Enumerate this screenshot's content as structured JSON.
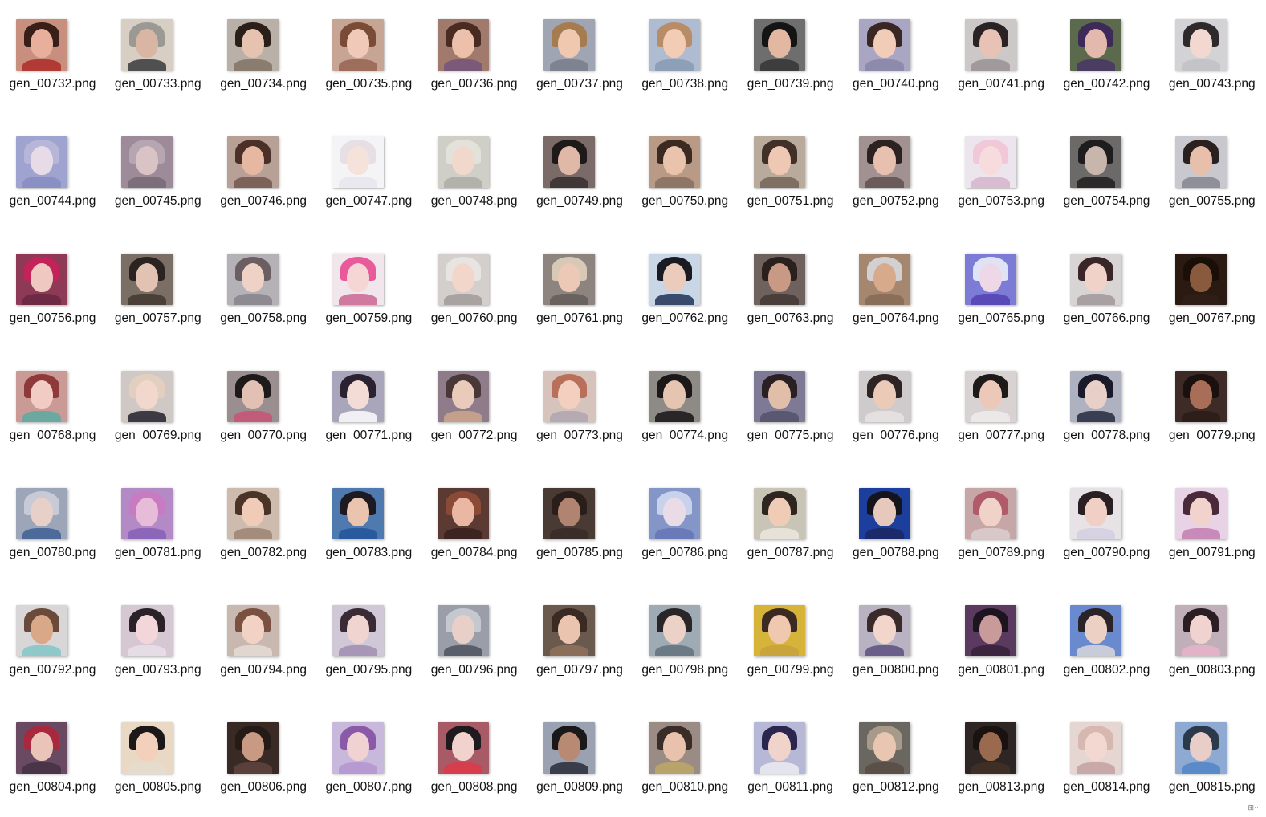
{
  "view": {
    "mode": "large-icons",
    "corner_glyph": "⊞⋯"
  },
  "files": [
    {
      "name": "gen_00732.png",
      "bg": "#c98f7e",
      "skin": "#e8b09c",
      "hair": "#3a1e18",
      "cloth": "#b23a34"
    },
    {
      "name": "gen_00733.png",
      "bg": "#d8cfc4",
      "skin": "#d9b6a4",
      "hair": "#9b9993",
      "cloth": "#505050"
    },
    {
      "name": "gen_00734.png",
      "bg": "#b9b0a8",
      "skin": "#e6c3b1",
      "hair": "#2b1f1a",
      "cloth": "#8a7c6e"
    },
    {
      "name": "gen_00735.png",
      "bg": "#c7a595",
      "skin": "#f0c9b8",
      "hair": "#7a4b36",
      "cloth": "#9d6e5c"
    },
    {
      "name": "gen_00736.png",
      "bg": "#a07a6c",
      "skin": "#ecc0aa",
      "hair": "#4a2b22",
      "cloth": "#7a5a78"
    },
    {
      "name": "gen_00737.png",
      "bg": "#9fa5b3",
      "skin": "#f0c8b0",
      "hair": "#a57c4f",
      "cloth": "#7f8391"
    },
    {
      "name": "gen_00738.png",
      "bg": "#aebbd0",
      "skin": "#f2ccb4",
      "hair": "#b88c66",
      "cloth": "#8e9fb8"
    },
    {
      "name": "gen_00739.png",
      "bg": "#6e6e6e",
      "skin": "#e2b8a2",
      "hair": "#141414",
      "cloth": "#3d3d3d"
    },
    {
      "name": "gen_00740.png",
      "bg": "#a8a6c2",
      "skin": "#f1ccb8",
      "hair": "#3a2622",
      "cloth": "#8d8aab"
    },
    {
      "name": "gen_00741.png",
      "bg": "#ccc8c8",
      "skin": "#e8c2b4",
      "hair": "#2a2326",
      "cloth": "#a09a9c"
    },
    {
      "name": "gen_00742.png",
      "bg": "#5b6a4c",
      "skin": "#e3b8ad",
      "hair": "#3d2a58",
      "cloth": "#4b3c62"
    },
    {
      "name": "gen_00743.png",
      "bg": "#d3d3d6",
      "skin": "#f2d8d0",
      "hair": "#2e2a2c",
      "cloth": "#c3c3c8"
    },
    {
      "name": "gen_00744.png",
      "bg": "#9ea4cf",
      "skin": "#e6dbe6",
      "hair": "#b8b6d8",
      "cloth": "#8a8fc4"
    },
    {
      "name": "gen_00745.png",
      "bg": "#9d8b9a",
      "skin": "#d9c3c4",
      "hair": "#b5a6b2",
      "cloth": "#7d6e7c"
    },
    {
      "name": "gen_00746.png",
      "bg": "#b7a197",
      "skin": "#e6b8a1",
      "hair": "#4a3026",
      "cloth": "#7c6258"
    },
    {
      "name": "gen_00747.png",
      "bg": "#f4f4f7",
      "skin": "#f5e2db",
      "hair": "#e6e0e4",
      "cloth": "#e8e8ee"
    },
    {
      "name": "gen_00748.png",
      "bg": "#cfcfc8",
      "skin": "#f1d8cd",
      "hair": "#e3e2da",
      "cloth": "#b2b2aa"
    },
    {
      "name": "gen_00749.png",
      "bg": "#7a6a68",
      "skin": "#e0b8a7",
      "hair": "#1f1a1a",
      "cloth": "#3f3738"
    },
    {
      "name": "gen_00750.png",
      "bg": "#b99a86",
      "skin": "#e9c3ab",
      "hair": "#3b2a22",
      "cloth": "#8e7666"
    },
    {
      "name": "gen_00751.png",
      "bg": "#b9ab9c",
      "skin": "#eec8b3",
      "hair": "#403028",
      "cloth": "#7e6f62"
    },
    {
      "name": "gen_00752.png",
      "bg": "#a19190",
      "skin": "#e8c0b0",
      "hair": "#2c2221",
      "cloth": "#6a5a5a"
    },
    {
      "name": "gen_00753.png",
      "bg": "#ece5ee",
      "skin": "#f6dcdc",
      "hair": "#f0c8d8",
      "cloth": "#d9bcd2"
    },
    {
      "name": "gen_00754.png",
      "bg": "#6c6a68",
      "skin": "#c8b6ac",
      "hair": "#1e1c1c",
      "cloth": "#2b2929"
    },
    {
      "name": "gen_00755.png",
      "bg": "#c8c8ce",
      "skin": "#e7bfaa",
      "hair": "#2a2020",
      "cloth": "#8f8f99"
    },
    {
      "name": "gen_00756.png",
      "bg": "#8e3a56",
      "skin": "#efc8c2",
      "hair": "#c2245a",
      "cloth": "#6e2a44"
    },
    {
      "name": "gen_00757.png",
      "bg": "#7b6e64",
      "skin": "#e2c2b2",
      "hair": "#2b2320",
      "cloth": "#4a4038"
    },
    {
      "name": "gen_00758.png",
      "bg": "#b4b2b6",
      "skin": "#eed2c6",
      "hair": "#6a5e62",
      "cloth": "#8e8a92"
    },
    {
      "name": "gen_00759.png",
      "bg": "#f0e6ec",
      "skin": "#f5d6d4",
      "hair": "#e85a9a",
      "cloth": "#d07aa0"
    },
    {
      "name": "gen_00760.png",
      "bg": "#d4cfcc",
      "skin": "#f3d6ca",
      "hair": "#e8e4e2",
      "cloth": "#a8a3a0"
    },
    {
      "name": "gen_00761.png",
      "bg": "#8d8480",
      "skin": "#ecc8b6",
      "hair": "#d8c8b6",
      "cloth": "#6a625e"
    },
    {
      "name": "gen_00762.png",
      "bg": "#c9d6e6",
      "skin": "#eacbbc",
      "hair": "#1a1a22",
      "cloth": "#3a4a6a"
    },
    {
      "name": "gen_00763.png",
      "bg": "#6f625e",
      "skin": "#c89a86",
      "hair": "#2a201c",
      "cloth": "#4a3e3a"
    },
    {
      "name": "gen_00764.png",
      "bg": "#a4876e",
      "skin": "#d8aa8c",
      "hair": "#d2d0d0",
      "cloth": "#8a6e58"
    },
    {
      "name": "gen_00765.png",
      "bg": "#7c7cd6",
      "skin": "#eed8e8",
      "hair": "#e0e2f6",
      "cloth": "#5a4ab8"
    },
    {
      "name": "gen_00766.png",
      "bg": "#d9d4d4",
      "skin": "#f0d2c8",
      "hair": "#3a2628",
      "cloth": "#a8a0a2"
    },
    {
      "name": "gen_00767.png",
      "bg": "#2a1a12",
      "skin": "#8a5a3e",
      "hair": "#1a0e08",
      "cloth": "#2e1e16"
    },
    {
      "name": "gen_00768.png",
      "bg": "#c99a96",
      "skin": "#f2ccc4",
      "hair": "#8e3a3a",
      "cloth": "#6aa8a0"
    },
    {
      "name": "gen_00769.png",
      "bg": "#cfc8c4",
      "skin": "#f2d8cc",
      "hair": "#e2cfc0",
      "cloth": "#3e3a44"
    },
    {
      "name": "gen_00770.png",
      "bg": "#9a8e90",
      "skin": "#e2c0b4",
      "hair": "#1e1a1c",
      "cloth": "#c25a7a"
    },
    {
      "name": "gen_00771.png",
      "bg": "#a9a6bc",
      "skin": "#f4dcd6",
      "hair": "#2a2230",
      "cloth": "#f0f0f4"
    },
    {
      "name": "gen_00772.png",
      "bg": "#8e7c8a",
      "skin": "#eacaba",
      "hair": "#4a3838",
      "cloth": "#c4a08c"
    },
    {
      "name": "gen_00773.png",
      "bg": "#d6c4bc",
      "skin": "#f2cfbe",
      "hair": "#b8705a",
      "cloth": "#b6aab2"
    },
    {
      "name": "gen_00774.png",
      "bg": "#8e8a86",
      "skin": "#e6c4b2",
      "hair": "#1c1818",
      "cloth": "#2a2628"
    },
    {
      "name": "gen_00775.png",
      "bg": "#7e7a96",
      "skin": "#e0bea8",
      "hair": "#2a2024",
      "cloth": "#5a5870"
    },
    {
      "name": "gen_00776.png",
      "bg": "#cfcacc",
      "skin": "#eccab8",
      "hair": "#2e2424",
      "cloth": "#e4e0e0"
    },
    {
      "name": "gen_00777.png",
      "bg": "#d8d2d2",
      "skin": "#ecc8b8",
      "hair": "#1e1a1a",
      "cloth": "#ece8e8"
    },
    {
      "name": "gen_00778.png",
      "bg": "#aeb2c0",
      "skin": "#e8d0c8",
      "hair": "#1a1a2a",
      "cloth": "#3a3e52"
    },
    {
      "name": "gen_00779.png",
      "bg": "#3e2a26",
      "skin": "#a86e58",
      "hair": "#1a100e",
      "cloth": "#2e1e1a"
    },
    {
      "name": "gen_00780.png",
      "bg": "#9ca6b8",
      "skin": "#e6d0c8",
      "hair": "#c8cad6",
      "cloth": "#4c6a9a"
    },
    {
      "name": "gen_00781.png",
      "bg": "#b48ac6",
      "skin": "#e6bcd8",
      "hair": "#c87ac2",
      "cloth": "#8c66b8"
    },
    {
      "name": "gen_00782.png",
      "bg": "#cdbcae",
      "skin": "#f0ccb8",
      "hair": "#4a3428",
      "cloth": "#a48c7c"
    },
    {
      "name": "gen_00783.png",
      "bg": "#4e7ab0",
      "skin": "#eac4ae",
      "hair": "#1e1a22",
      "cloth": "#2a5a9e"
    },
    {
      "name": "gen_00784.png",
      "bg": "#5a3a32",
      "skin": "#eab8a2",
      "hair": "#8a4a36",
      "cloth": "#3e2420"
    },
    {
      "name": "gen_00785.png",
      "bg": "#4a3a34",
      "skin": "#b08470",
      "hair": "#2a1e1a",
      "cloth": "#3a2c28"
    },
    {
      "name": "gen_00786.png",
      "bg": "#8496c8",
      "skin": "#eadce6",
      "hair": "#c8d2ec",
      "cloth": "#6a7ab8"
    },
    {
      "name": "gen_00787.png",
      "bg": "#c8c4b6",
      "skin": "#f0ccb6",
      "hair": "#2e2420",
      "cloth": "#e6e2d8"
    },
    {
      "name": "gen_00788.png",
      "bg": "#1c3e9c",
      "skin": "#e6c8bc",
      "hair": "#14141c",
      "cloth": "#1a2a6a"
    },
    {
      "name": "gen_00789.png",
      "bg": "#c6a6a6",
      "skin": "#f0d2c8",
      "hair": "#b05a6a",
      "cloth": "#d8c8c8"
    },
    {
      "name": "gen_00790.png",
      "bg": "#e6e2e6",
      "skin": "#f0d0c4",
      "hair": "#2a2024",
      "cloth": "#d6d2e2"
    },
    {
      "name": "gen_00791.png",
      "bg": "#e8d2e6",
      "skin": "#f2d2cc",
      "hair": "#4a2a3a",
      "cloth": "#c88ab8"
    },
    {
      "name": "gen_00792.png",
      "bg": "#d8d6d6",
      "skin": "#d8a888",
      "hair": "#6a4a3a",
      "cloth": "#8ec8c8"
    },
    {
      "name": "gen_00793.png",
      "bg": "#d6c8d2",
      "skin": "#f2d6da",
      "hair": "#2a2228",
      "cloth": "#e6dce6"
    },
    {
      "name": "gen_00794.png",
      "bg": "#c8b8b0",
      "skin": "#f2d2c4",
      "hair": "#7a5040",
      "cloth": "#e2d6d0"
    },
    {
      "name": "gen_00795.png",
      "bg": "#d0c8d6",
      "skin": "#f0d4d0",
      "hair": "#3a2a36",
      "cloth": "#a896b6"
    },
    {
      "name": "gen_00796.png",
      "bg": "#9a9ea8",
      "skin": "#e8d0c8",
      "hair": "#c6c8d0",
      "cloth": "#5a5e6a"
    },
    {
      "name": "gen_00797.png",
      "bg": "#6a5a4e",
      "skin": "#eac4ae",
      "hair": "#3a2a22",
      "cloth": "#8a6e5a"
    },
    {
      "name": "gen_00798.png",
      "bg": "#9eaab4",
      "skin": "#ecd2c6",
      "hair": "#2a2628",
      "cloth": "#6c7a86"
    },
    {
      "name": "gen_00799.png",
      "bg": "#d6b43a",
      "skin": "#f0c8b0",
      "hair": "#3a2a22",
      "cloth": "#c8a43a"
    },
    {
      "name": "gen_00800.png",
      "bg": "#b8b2c2",
      "skin": "#f2d6cc",
      "hair": "#3a2a2a",
      "cloth": "#6a5e8a"
    },
    {
      "name": "gen_00801.png",
      "bg": "#5a3a5e",
      "skin": "#c89a9a",
      "hair": "#1e1420",
      "cloth": "#3a243e"
    },
    {
      "name": "gen_00802.png",
      "bg": "#6a8ad0",
      "skin": "#ecd0c4",
      "hair": "#2a2428",
      "cloth": "#c8ccd8"
    },
    {
      "name": "gen_00803.png",
      "bg": "#c0aeb8",
      "skin": "#f0d2ce",
      "hair": "#2a1e24",
      "cloth": "#e2b2c6"
    },
    {
      "name": "gen_00804.png",
      "bg": "#6a4a62",
      "skin": "#eac4b8",
      "hair": "#a8283e",
      "cloth": "#4a3448"
    },
    {
      "name": "gen_00805.png",
      "bg": "#e8d8c4",
      "skin": "#f2d0bc",
      "hair": "#1c181a",
      "cloth": "#e6dccc"
    },
    {
      "name": "gen_00806.png",
      "bg": "#3a2a26",
      "skin": "#c89a84",
      "hair": "#241a16",
      "cloth": "#5a403a"
    },
    {
      "name": "gen_00807.png",
      "bg": "#c8b8dc",
      "skin": "#f0d2d2",
      "hair": "#8a5aa8",
      "cloth": "#b89ad2"
    },
    {
      "name": "gen_00808.png",
      "bg": "#a85a66",
      "skin": "#f2d2cc",
      "hair": "#1e1a1e",
      "cloth": "#d63e4e"
    },
    {
      "name": "gen_00809.png",
      "bg": "#9aa2b2",
      "skin": "#b88a74",
      "hair": "#1a1818",
      "cloth": "#3a3e4a"
    },
    {
      "name": "gen_00810.png",
      "bg": "#9a8c84",
      "skin": "#e8c2ac",
      "hair": "#3a2c26",
      "cloth": "#b8a46a"
    },
    {
      "name": "gen_00811.png",
      "bg": "#b6b8d6",
      "skin": "#f0d4cc",
      "hair": "#2a2650",
      "cloth": "#e4e4ee"
    },
    {
      "name": "gen_00812.png",
      "bg": "#6a6660",
      "skin": "#e8c6b2",
      "hair": "#a89a8a",
      "cloth": "#5a5048"
    },
    {
      "name": "gen_00813.png",
      "bg": "#2e2624",
      "skin": "#9a6a4e",
      "hair": "#1a1210",
      "cloth": "#3e2e26"
    },
    {
      "name": "gen_00814.png",
      "bg": "#e6d6d2",
      "skin": "#f2d8d0",
      "hair": "#d6b8b0",
      "cloth": "#c8a8a8"
    },
    {
      "name": "gen_00815.png",
      "bg": "#8eaad2",
      "skin": "#e8cec6",
      "hair": "#2a3a4a",
      "cloth": "#5a8ac8"
    }
  ]
}
